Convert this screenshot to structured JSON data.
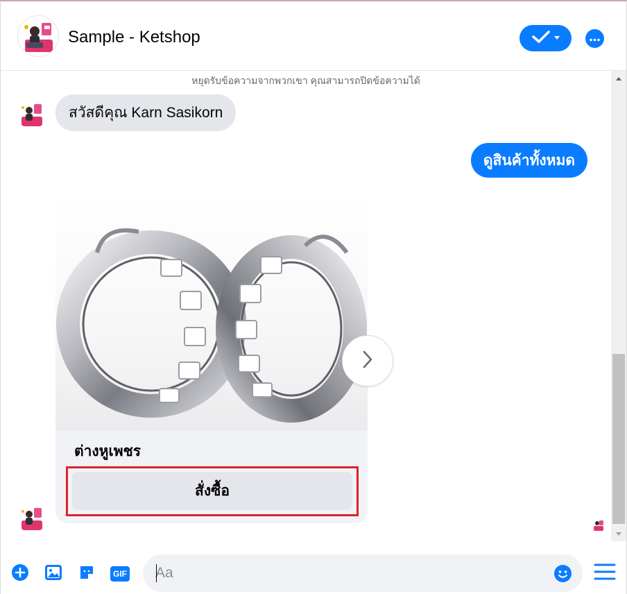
{
  "header": {
    "page_name": "Sample - Ketshop",
    "done_icon": "checkmark-icon",
    "more_icon": "more-horizontal-icon"
  },
  "chat": {
    "notice": "หยุดรับข้อความจากพวกเขา คุณสามารถปิดข้อความได้",
    "greeting": "สวัสดีคุณ Karn Sasikorn",
    "reply": "ดูสินค้าทั้งหมด",
    "card": {
      "title": "ต่างหูเพชร",
      "button": "สั่งซื้อ"
    }
  },
  "composer": {
    "placeholder": "Aa",
    "tools": [
      "add-icon",
      "photo-icon",
      "sticker-icon",
      "gif-icon"
    ],
    "gif_label": "GIF"
  },
  "colors": {
    "accent": "#0a7cff",
    "bubble_in": "#e4e6eb",
    "highlight": "#e0202a"
  }
}
